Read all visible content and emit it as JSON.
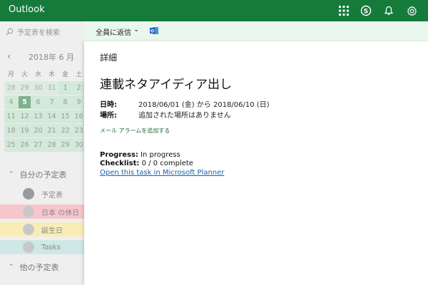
{
  "app": {
    "title": "Outlook"
  },
  "topbar": {
    "icons": [
      "app-launcher-icon",
      "skype-icon",
      "notification-bell-icon",
      "settings-gear-icon"
    ]
  },
  "sidebar": {
    "search_placeholder": "予定表を検索",
    "calendar": {
      "month_label": "2018年 6 月",
      "weekdays": [
        "月",
        "火",
        "水",
        "木",
        "金",
        "土"
      ],
      "weeks": [
        [
          "28",
          "29",
          "30",
          "31",
          "1",
          "2"
        ],
        [
          "4",
          "5",
          "6",
          "7",
          "8",
          "9"
        ],
        [
          "11",
          "12",
          "13",
          "14",
          "15",
          "16"
        ],
        [
          "18",
          "19",
          "20",
          "21",
          "22",
          "23"
        ],
        [
          "25",
          "26",
          "27",
          "28",
          "29",
          "30"
        ]
      ],
      "today": "5"
    },
    "my_calendars_label": "自分の予定表",
    "items": [
      {
        "label": "予定表",
        "color": "#c8c8c8"
      },
      {
        "label": "日本 の休日",
        "color": "#f7c6cc"
      },
      {
        "label": "誕生日",
        "color": "#f9edb7"
      },
      {
        "label": "Tasks",
        "color": "#cfe8e6"
      }
    ],
    "other_calendars_label": "他の予定表"
  },
  "toolbar": {
    "reply_all_label": "全員に返信",
    "reply_sep": "|"
  },
  "detail": {
    "heading": "詳細",
    "title": "連載ネタアイディア出し",
    "datetime_label": "日時:",
    "datetime_value": "2018/06/01 (金) から 2018/06/10 (日)",
    "location_label": "場所:",
    "location_value": "追加された場所はありません",
    "add_alarm": "メール アラームを追加する",
    "progress_label": "Progress:",
    "progress_value": " In progress",
    "checklist_label": "Checklist:",
    "checklist_value": " 0 / 0 complete",
    "planner_link": "Open this task in Microsoft Planner"
  },
  "colors": {
    "accent": "#167a3b",
    "toolbar_bg": "#eaf7ee",
    "link": "#1660b5"
  }
}
